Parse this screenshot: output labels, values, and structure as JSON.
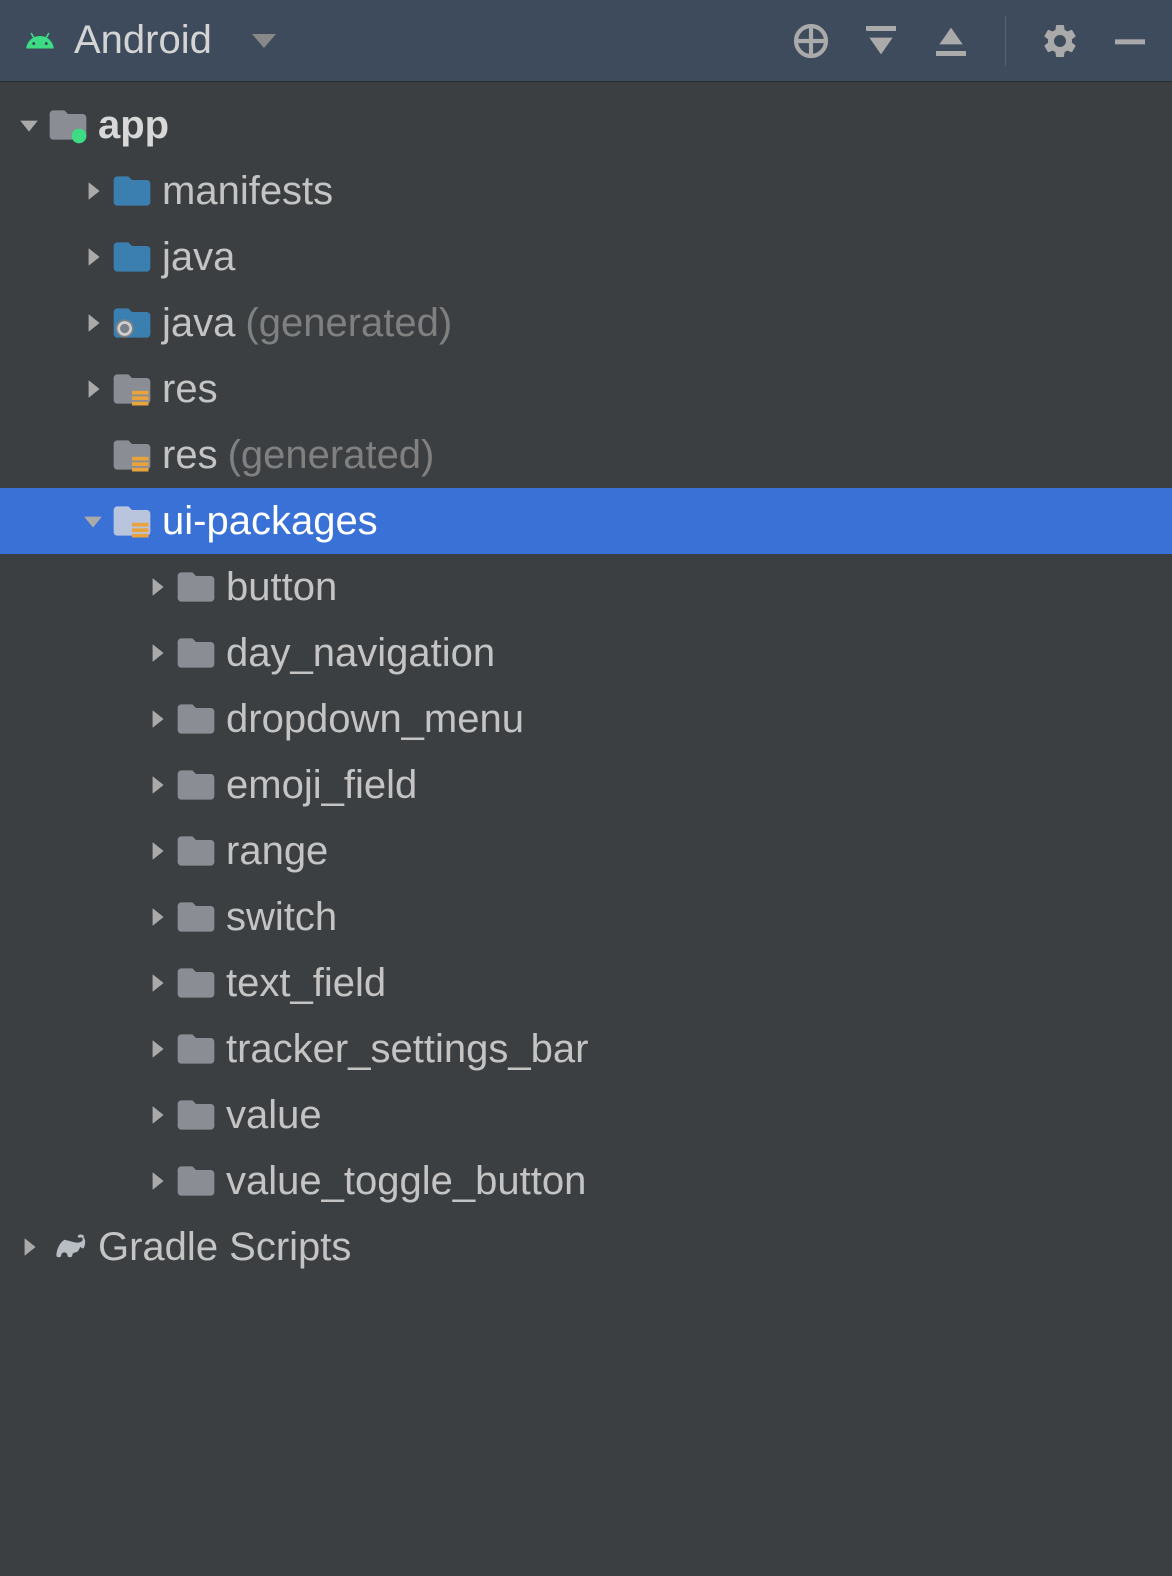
{
  "header": {
    "title": "Android"
  },
  "tree": {
    "root": {
      "label": "app"
    },
    "level1": [
      {
        "label": "manifests",
        "suffix": "",
        "expanded": false,
        "hasChevron": true,
        "icon": "folder-blue"
      },
      {
        "label": "java",
        "suffix": "",
        "expanded": false,
        "hasChevron": true,
        "icon": "folder-blue"
      },
      {
        "label": "java",
        "suffix": "(generated)",
        "expanded": false,
        "hasChevron": true,
        "icon": "folder-gen"
      },
      {
        "label": "res",
        "suffix": "",
        "expanded": false,
        "hasChevron": true,
        "icon": "folder-res"
      },
      {
        "label": "res",
        "suffix": "(generated)",
        "expanded": false,
        "hasChevron": false,
        "icon": "folder-res"
      },
      {
        "label": "ui-packages",
        "suffix": "",
        "expanded": true,
        "hasChevron": true,
        "icon": "folder-res",
        "selected": true
      }
    ],
    "level2": [
      {
        "label": "button"
      },
      {
        "label": "day_navigation"
      },
      {
        "label": "dropdown_menu"
      },
      {
        "label": "emoji_field"
      },
      {
        "label": "range"
      },
      {
        "label": "switch"
      },
      {
        "label": "text_field"
      },
      {
        "label": "tracker_settings_bar"
      },
      {
        "label": "value"
      },
      {
        "label": "value_toggle_button"
      }
    ],
    "gradle": {
      "label": "Gradle Scripts"
    }
  }
}
